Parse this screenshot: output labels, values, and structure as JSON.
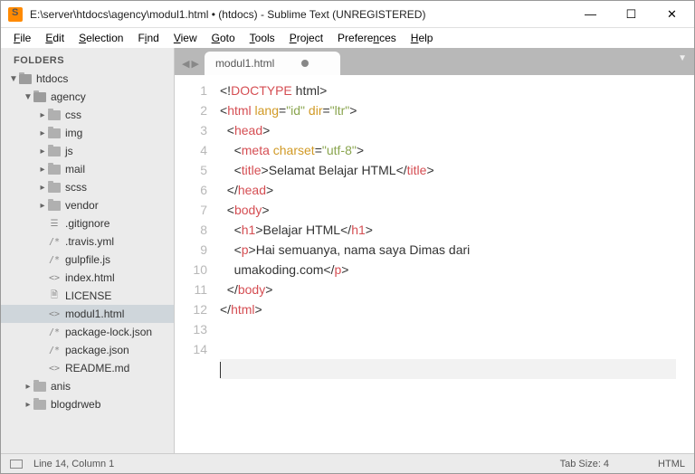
{
  "titlebar": {
    "title": "E:\\server\\htdocs\\agency\\modul1.html • (htdocs) - Sublime Text (UNREGISTERED)"
  },
  "menu": {
    "file": "File",
    "edit": "Edit",
    "selection": "Selection",
    "find": "Find",
    "view": "View",
    "goto": "Goto",
    "tools": "Tools",
    "project": "Project",
    "preferences": "Preferences",
    "help": "Help"
  },
  "sidebar": {
    "header": "FOLDERS",
    "tree": {
      "htdocs": "htdocs",
      "agency": "agency",
      "css": "css",
      "img": "img",
      "js": "js",
      "mail": "mail",
      "scss": "scss",
      "vendor": "vendor",
      "gitignore": ".gitignore",
      "travis": ".travis.yml",
      "gulpfile": "gulpfile.js",
      "indexhtml": "index.html",
      "license": "LICENSE",
      "modul1": "modul1.html",
      "packagelock": "package-lock.json",
      "package": "package.json",
      "readme": "README.md",
      "anis": "anis",
      "blogdrweb": "blogdrweb"
    }
  },
  "tabs": {
    "active": "modul1.html"
  },
  "gutter": {
    "l1": "1",
    "l2": "2",
    "l3": "3",
    "l4": "4",
    "l5": "5",
    "l6": "6",
    "l7": "7",
    "l8": "8",
    "l9": "9",
    "l10": "10",
    "l11": "11",
    "l12": "12",
    "l13": "13",
    "l14": "14"
  },
  "code": {
    "doctype_kw": "DOCTYPE",
    "doctype_rest": " html",
    "html": "html",
    "lang_attr": "lang",
    "lang_val": "\"id\"",
    "dir_attr": "dir",
    "dir_val": "\"ltr\"",
    "head": "head",
    "meta": "meta",
    "charset_attr": "charset",
    "charset_val": "\"utf-8\"",
    "title": "title",
    "title_text": "Selamat Belajar HTML",
    "body": "body",
    "h1": "h1",
    "h1_text": "Belajar HTML",
    "p": "p",
    "p_text1": "Hai semuanya, nama saya Dimas dari ",
    "p_text2": "umakoding.com"
  },
  "statusbar": {
    "pos": "Line 14, Column 1",
    "tabsize": "Tab Size: 4",
    "lang": "HTML"
  }
}
